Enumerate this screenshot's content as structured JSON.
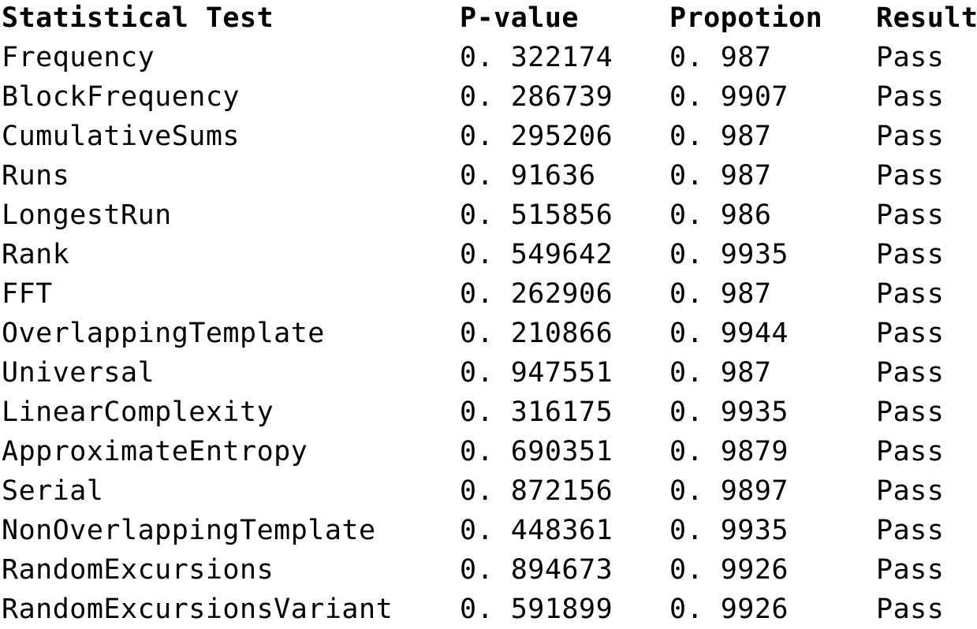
{
  "table": {
    "columns": [
      {
        "key": "test",
        "label": "Statistical Test"
      },
      {
        "key": "pvalue",
        "label": "P-value"
      },
      {
        "key": "prop",
        "label": "Propotion"
      },
      {
        "key": "result",
        "label": "Result"
      }
    ],
    "rows": [
      {
        "test": "Frequency",
        "pvalue": "0. 322174",
        "prop": "0. 987",
        "result": "Pass"
      },
      {
        "test": "BlockFrequency",
        "pvalue": "0. 286739",
        "prop": "0. 9907",
        "result": "Pass"
      },
      {
        "test": "CumulativeSums",
        "pvalue": "0. 295206",
        "prop": "0. 987",
        "result": "Pass"
      },
      {
        "test": "Runs",
        "pvalue": "0. 91636",
        "prop": "0. 987",
        "result": "Pass"
      },
      {
        "test": "LongestRun",
        "pvalue": "0. 515856",
        "prop": "0. 986",
        "result": "Pass"
      },
      {
        "test": "Rank",
        "pvalue": "0. 549642",
        "prop": "0. 9935",
        "result": "Pass"
      },
      {
        "test": "FFT",
        "pvalue": "0. 262906",
        "prop": "0. 987",
        "result": "Pass"
      },
      {
        "test": "OverlappingTemplate",
        "pvalue": "0. 210866",
        "prop": "0. 9944",
        "result": "Pass"
      },
      {
        "test": "Universal",
        "pvalue": "0. 947551",
        "prop": "0. 987",
        "result": "Pass"
      },
      {
        "test": "LinearComplexity",
        "pvalue": "0. 316175",
        "prop": "0. 9935",
        "result": "Pass"
      },
      {
        "test": "ApproximateEntropy",
        "pvalue": "0. 690351",
        "prop": "0. 9879",
        "result": "Pass"
      },
      {
        "test": "Serial",
        "pvalue": "0. 872156",
        "prop": "0. 9897",
        "result": "Pass"
      },
      {
        "test": "NonOverlappingTemplate",
        "pvalue": "0. 448361",
        "prop": "0. 9935",
        "result": "Pass"
      },
      {
        "test": "RandomExcursions",
        "pvalue": "0. 894673",
        "prop": "0. 9926",
        "result": "Pass"
      },
      {
        "test": "RandomExcursionsVariant",
        "pvalue": "0. 591899",
        "prop": "0. 9926",
        "result": "Pass"
      }
    ]
  },
  "chart_data": {
    "type": "table",
    "title": "",
    "columns": [
      "Statistical Test",
      "P-value",
      "Propotion",
      "Result"
    ],
    "rows": [
      [
        "Frequency",
        0.322174,
        0.987,
        "Pass"
      ],
      [
        "BlockFrequency",
        0.286739,
        0.9907,
        "Pass"
      ],
      [
        "CumulativeSums",
        0.295206,
        0.987,
        "Pass"
      ],
      [
        "Runs",
        0.91636,
        0.987,
        "Pass"
      ],
      [
        "LongestRun",
        0.515856,
        0.986,
        "Pass"
      ],
      [
        "Rank",
        0.549642,
        0.9935,
        "Pass"
      ],
      [
        "FFT",
        0.262906,
        0.987,
        "Pass"
      ],
      [
        "OverlappingTemplate",
        0.210866,
        0.9944,
        "Pass"
      ],
      [
        "Universal",
        0.947551,
        0.987,
        "Pass"
      ],
      [
        "LinearComplexity",
        0.316175,
        0.9935,
        "Pass"
      ],
      [
        "ApproximateEntropy",
        0.690351,
        0.9879,
        "Pass"
      ],
      [
        "Serial",
        0.872156,
        0.9897,
        "Pass"
      ],
      [
        "NonOverlappingTemplate",
        0.448361,
        0.9935,
        "Pass"
      ],
      [
        "RandomExcursions",
        0.894673,
        0.9926,
        "Pass"
      ],
      [
        "RandomExcursionsVariant",
        0.591899,
        0.9926,
        "Pass"
      ]
    ]
  }
}
